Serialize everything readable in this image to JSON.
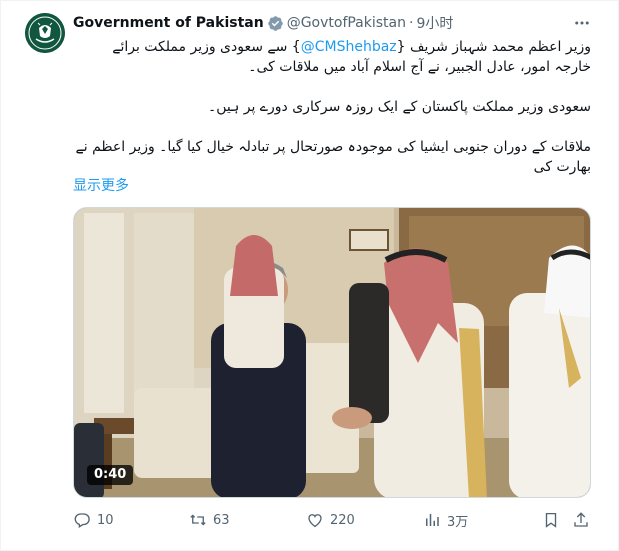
{
  "account": {
    "display_name": "Government of Pakistan",
    "handle": "@GovtofPakistan",
    "separator": "·",
    "time": "9小时"
  },
  "post": {
    "line1_pre": "وزیر اعظم محمد شہباز شریف {",
    "mention": "@CMShehbaz",
    "line1_post": "} سے سعودی وزیر مملکت برائے خارجہ امور، عادل الجبیر، نے آج اسلام آباد میں ملاقات کی۔",
    "paragraph2": "سعودی وزیر مملکت پاکستان کے ایک روزہ سرکاری دورے پر ہیں۔",
    "paragraph3": "ملاقات کے دوران جنوبی ایشیا کی موجودہ صورتحال پر تبادلہ خیال کیا گیا۔ وزیر اعظم نے بھارت کی",
    "show_more": "显示更多"
  },
  "media": {
    "duration": "0:40"
  },
  "actions": {
    "replies": "10",
    "reposts": "63",
    "likes": "220",
    "views": "3万"
  },
  "colors": {
    "accent": "#1d9bf0",
    "verified": "#829aab",
    "secondary_text": "#536471",
    "avatar_bg": "#115740"
  },
  "icons": [
    "more-icon",
    "verified-badge-icon",
    "reply-icon",
    "repost-icon",
    "like-icon",
    "views-icon",
    "bookmark-icon",
    "share-icon"
  ]
}
